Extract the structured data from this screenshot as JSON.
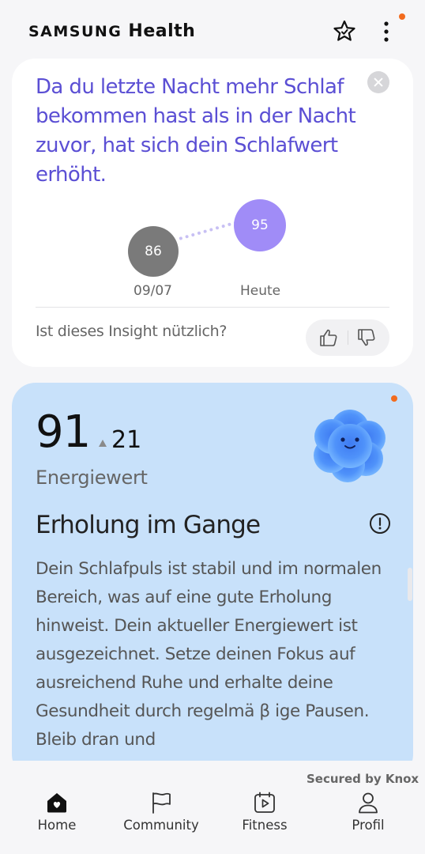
{
  "header": {
    "brand_primary": "SAMSUNG",
    "brand_secondary": "Health",
    "icons": [
      "favorites-star-icon",
      "more-vert-icon"
    ],
    "notification_dot_color": "#f26b1d"
  },
  "insight": {
    "text": "Da du letzte Nacht mehr Schlaf bekommen hast als in der Nacht zuvor, hat sich dein Schlafwert erhöht.",
    "previous": {
      "value": "86",
      "label": "09/07"
    },
    "today": {
      "value": "95",
      "label": "Heute"
    },
    "question": "Ist dieses Insight nützlich?",
    "accent_color": "#5b4fd4"
  },
  "energy": {
    "score": "91",
    "delta": "21",
    "label": "Energiewert",
    "title": "Erholung im Gange",
    "body": "Dein Schlafpuls ist stabil und im normalen Bereich, was auf eine gute Erholung hinweist. Dein aktueller Energiewert ist ausgezeichnet. Setze deinen Fokus auf ausreichend Ruhe und erhalte deine Gesundheit durch regelmä β ige Pausen. Bleib dran und",
    "card_color": "#c8e1fa"
  },
  "footer": {
    "secured": "Secured by Knox"
  },
  "nav": {
    "items": [
      {
        "label": "Home",
        "icon": "home-heart-icon"
      },
      {
        "label": "Community",
        "icon": "flag-icon"
      },
      {
        "label": "Fitness",
        "icon": "video-calendar-icon"
      },
      {
        "label": "Profil",
        "icon": "person-icon"
      }
    ]
  }
}
